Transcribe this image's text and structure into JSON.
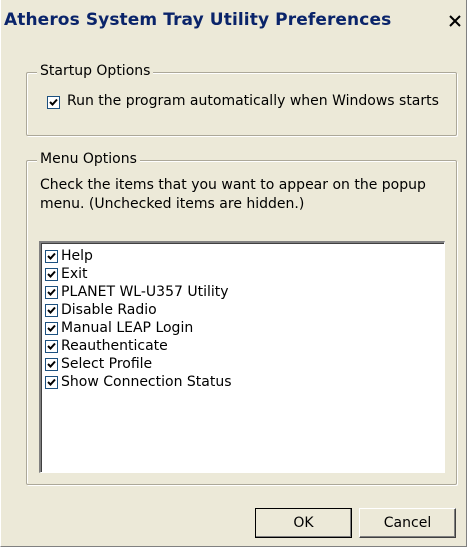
{
  "window": {
    "title": "Atheros System Tray Utility Preferences",
    "close_glyph": "X"
  },
  "startup": {
    "legend": "Startup Options",
    "run_label": "Run the program automatically when Windows starts",
    "run_checked": true
  },
  "menu": {
    "legend": "Menu Options",
    "instructions": "Check the items that you want to appear on the popup\nmenu. (Unchecked items are hidden.)",
    "items": [
      {
        "label": "Help",
        "checked": true
      },
      {
        "label": "Exit",
        "checked": true
      },
      {
        "label": "PLANET WL-U357 Utility",
        "checked": true
      },
      {
        "label": "Disable Radio",
        "checked": true
      },
      {
        "label": "Manual LEAP Login",
        "checked": true
      },
      {
        "label": "Reauthenticate",
        "checked": true
      },
      {
        "label": "Select Profile",
        "checked": true
      },
      {
        "label": "Show Connection Status",
        "checked": true
      }
    ]
  },
  "buttons": {
    "ok": "OK",
    "cancel": "Cancel"
  },
  "icons": {
    "close": "close-icon",
    "check": "checkmark-icon"
  },
  "colors": {
    "title_text": "#0a246a",
    "face": "#ece9d8",
    "list_bg": "#ffffff"
  }
}
